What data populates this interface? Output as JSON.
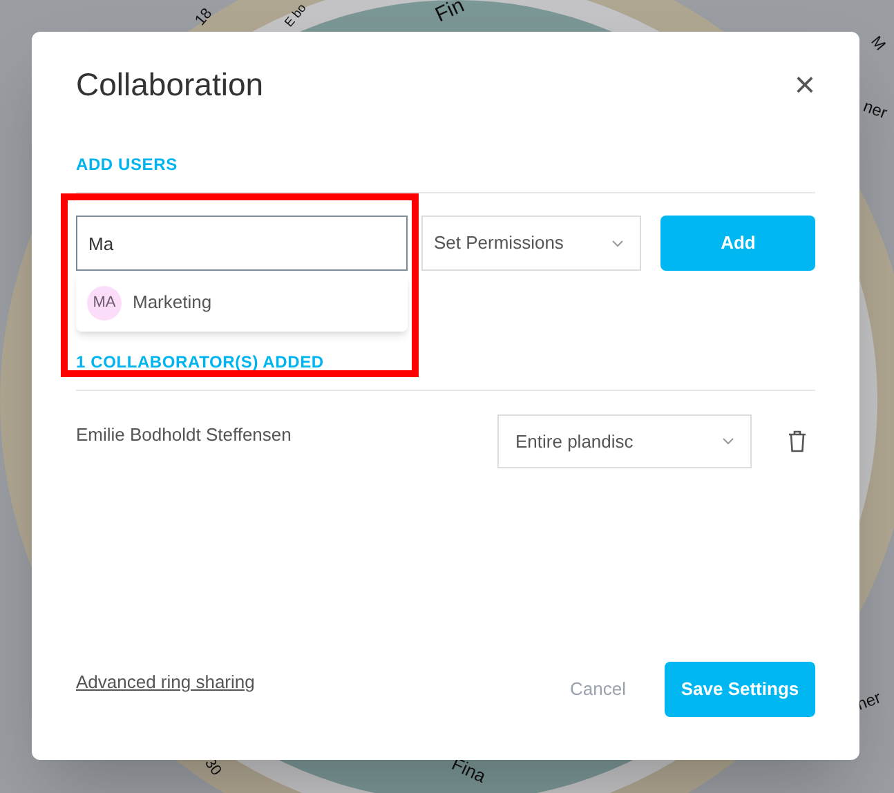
{
  "background_labels": [
    "18",
    "E bo",
    "Fin",
    "M",
    "ner",
    "30",
    "Fina",
    "ner"
  ],
  "dialog": {
    "title": "Collaboration",
    "close": "×"
  },
  "add_users": {
    "heading": "ADD USERS",
    "search": {
      "value": "Ma"
    },
    "suggestions": [
      {
        "initials": "MA",
        "label": "Marketing"
      }
    ],
    "permission_select": {
      "placeholder": "Set Permissions"
    },
    "add_button": "Add"
  },
  "collaborators": {
    "heading": "1 COLLABORATOR(S) ADDED",
    "rows": [
      {
        "name": "Emilie Bodholdt Steffensen",
        "permission": "Entire plandisc"
      }
    ]
  },
  "footer": {
    "link": "Advanced ring sharing",
    "cancel": "Cancel",
    "save": "Save Settings"
  }
}
